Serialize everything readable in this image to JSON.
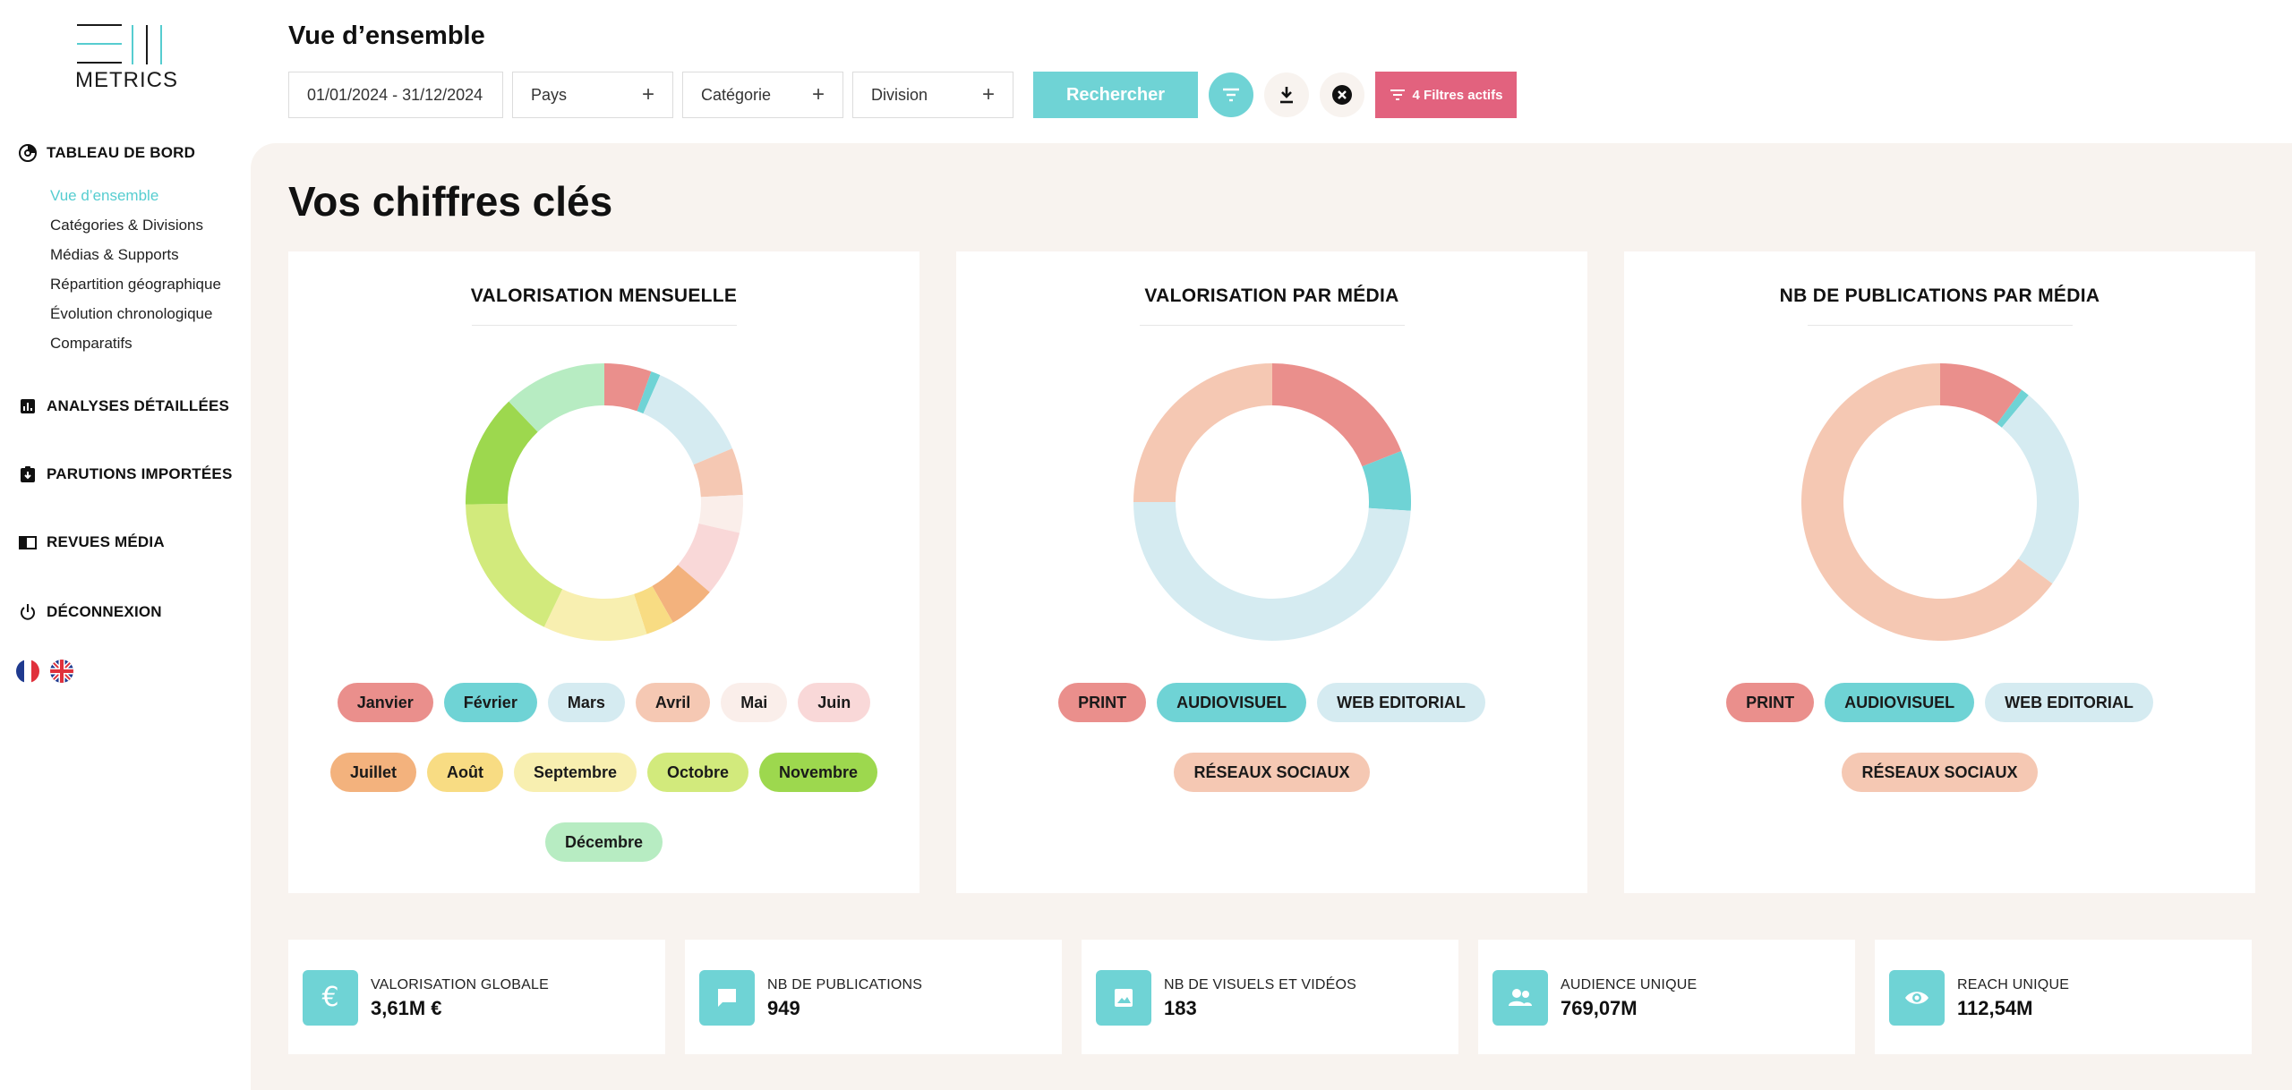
{
  "logo": {
    "text": "METRICS"
  },
  "sidebar": {
    "sections": [
      {
        "label": "TABLEAU DE BORD",
        "icon": "dashboard-icon"
      },
      {
        "label": "ANALYSES DÉTAILLÉES",
        "icon": "bar-chart-icon"
      },
      {
        "label": "PARUTIONS IMPORTÉES",
        "icon": "import-icon"
      },
      {
        "label": "REVUES MÉDIA",
        "icon": "book-icon"
      },
      {
        "label": "DÉCONNEXION",
        "icon": "power-icon"
      }
    ],
    "subitems": [
      {
        "label": "Vue d’ensemble",
        "active": true
      },
      {
        "label": "Catégories & Divisions"
      },
      {
        "label": "Médias & Supports"
      },
      {
        "label": "Répartition géographique"
      },
      {
        "label": "Évolution chronologique"
      },
      {
        "label": "Comparatifs"
      }
    ],
    "languages": [
      "fr-flag-icon",
      "uk-flag-icon"
    ]
  },
  "header": {
    "title": "Vue d’ensemble",
    "date_range": "01/01/2024 - 31/12/2024",
    "country_placeholder": "Pays",
    "category_placeholder": "Catégorie",
    "division_placeholder": "Division",
    "search_label": "Rechercher",
    "active_filters_label": "4 Filtres actifs"
  },
  "main": {
    "title": "Vos chiffres clés"
  },
  "colors": {
    "accent": "#6fd3d5",
    "active_filters": "#e2627e",
    "background": "#f8f3ef"
  },
  "charts": [
    {
      "title": "VALORISATION MENSUELLE",
      "legend": [
        {
          "label": "Janvier",
          "color": "#ea8f8c"
        },
        {
          "label": "Février",
          "color": "#6fd3d5"
        },
        {
          "label": "Mars",
          "color": "#d5ebf1"
        },
        {
          "label": "Avril",
          "color": "#f5c8b3"
        },
        {
          "label": "Mai",
          "color": "#faeeea"
        },
        {
          "label": "Juin",
          "color": "#f9d8d8"
        },
        {
          "label": "Juillet",
          "color": "#f3b27d"
        },
        {
          "label": "Août",
          "color": "#f8dc83"
        },
        {
          "label": "Septembre",
          "color": "#f8efb0"
        },
        {
          "label": "Octobre",
          "color": "#d2ea7c"
        },
        {
          "label": "Novembre",
          "color": "#9dd84e"
        },
        {
          "label": "Décembre",
          "color": "#b7ecc2"
        }
      ]
    },
    {
      "title": "VALORISATION PAR MÉDIA",
      "legend": [
        {
          "label": "PRINT",
          "color": "#ea8f8c"
        },
        {
          "label": "AUDIOVISUEL",
          "color": "#6fd3d5"
        },
        {
          "label": "WEB EDITORIAL",
          "color": "#d5ebf1"
        },
        {
          "label": "RÉSEAUX SOCIAUX",
          "color": "#f5c8b3"
        }
      ]
    },
    {
      "title": "NB DE PUBLICATIONS PAR MÉDIA",
      "legend": [
        {
          "label": "PRINT",
          "color": "#ea8f8c"
        },
        {
          "label": "AUDIOVISUEL",
          "color": "#6fd3d5"
        },
        {
          "label": "WEB EDITORIAL",
          "color": "#d5ebf1"
        },
        {
          "label": "RÉSEAUX SOCIAUX",
          "color": "#f5c8b3"
        }
      ]
    }
  ],
  "chart_data": [
    {
      "type": "pie",
      "title": "VALORISATION MENSUELLE",
      "categories": [
        "Janvier",
        "Février",
        "Mars",
        "Avril",
        "Mai",
        "Juin",
        "Juillet",
        "Août",
        "Septembre",
        "Octobre",
        "Novembre",
        "Décembre"
      ],
      "values": [
        5,
        1,
        11,
        5,
        4,
        7,
        5,
        3,
        11,
        16,
        12,
        11
      ],
      "unit": "%"
    },
    {
      "type": "pie",
      "title": "VALORISATION PAR MÉDIA",
      "categories": [
        "PRINT",
        "AUDIOVISUEL",
        "WEB EDITORIAL",
        "RÉSEAUX SOCIAUX"
      ],
      "values": [
        19,
        7,
        49,
        25
      ],
      "unit": "%"
    },
    {
      "type": "pie",
      "title": "NB DE PUBLICATIONS PAR MÉDIA",
      "categories": [
        "PRINT",
        "AUDIOVISUEL",
        "WEB EDITORIAL",
        "RÉSEAUX SOCIAUX"
      ],
      "values": [
        10,
        1,
        24,
        65
      ],
      "unit": "%"
    }
  ],
  "kpis": [
    {
      "label": "VALORISATION GLOBALE",
      "value": "3,61M €",
      "icon": "euro-icon"
    },
    {
      "label": "NB DE PUBLICATIONS",
      "value": "949",
      "icon": "message-icon"
    },
    {
      "label": "NB DE VISUELS ET VIDÉOS",
      "value": "183",
      "icon": "image-icon"
    },
    {
      "label": "AUDIENCE UNIQUE",
      "value": "769,07M",
      "icon": "people-icon"
    },
    {
      "label": "REACH UNIQUE",
      "value": "112,54M",
      "icon": "eye-icon"
    }
  ]
}
